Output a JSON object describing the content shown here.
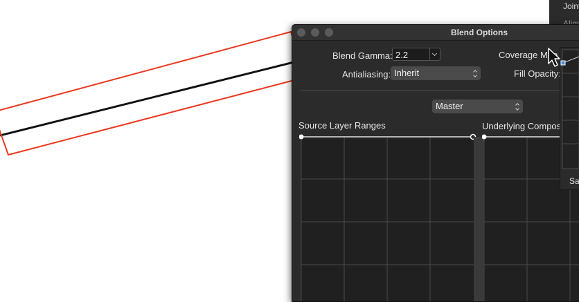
{
  "background_panel": {
    "joint_label": "Joint",
    "align_label": "Align"
  },
  "dialog": {
    "title": "Blend Options",
    "blend_gamma": {
      "label": "Blend Gamma:",
      "value": "2.2"
    },
    "antialiasing": {
      "label": "Antialiasing:",
      "value": "Inherit"
    },
    "coverage_map": {
      "label": "Coverage Map"
    },
    "fill_opacity": {
      "label": "Fill Opacity:"
    },
    "channel": {
      "value": "Master"
    },
    "source_layer_ranges": {
      "label": "Source Layer Ranges"
    },
    "underlying_composition": {
      "label": "Underlying Compos"
    },
    "coverage_popover": {
      "save_label": "Sa"
    }
  },
  "colors": {
    "selection_outline": "#e8391f",
    "dialog_bg": "#2b2b2b",
    "grid_line": "#4a4a4a",
    "curve_handle": "#4a90e2"
  }
}
